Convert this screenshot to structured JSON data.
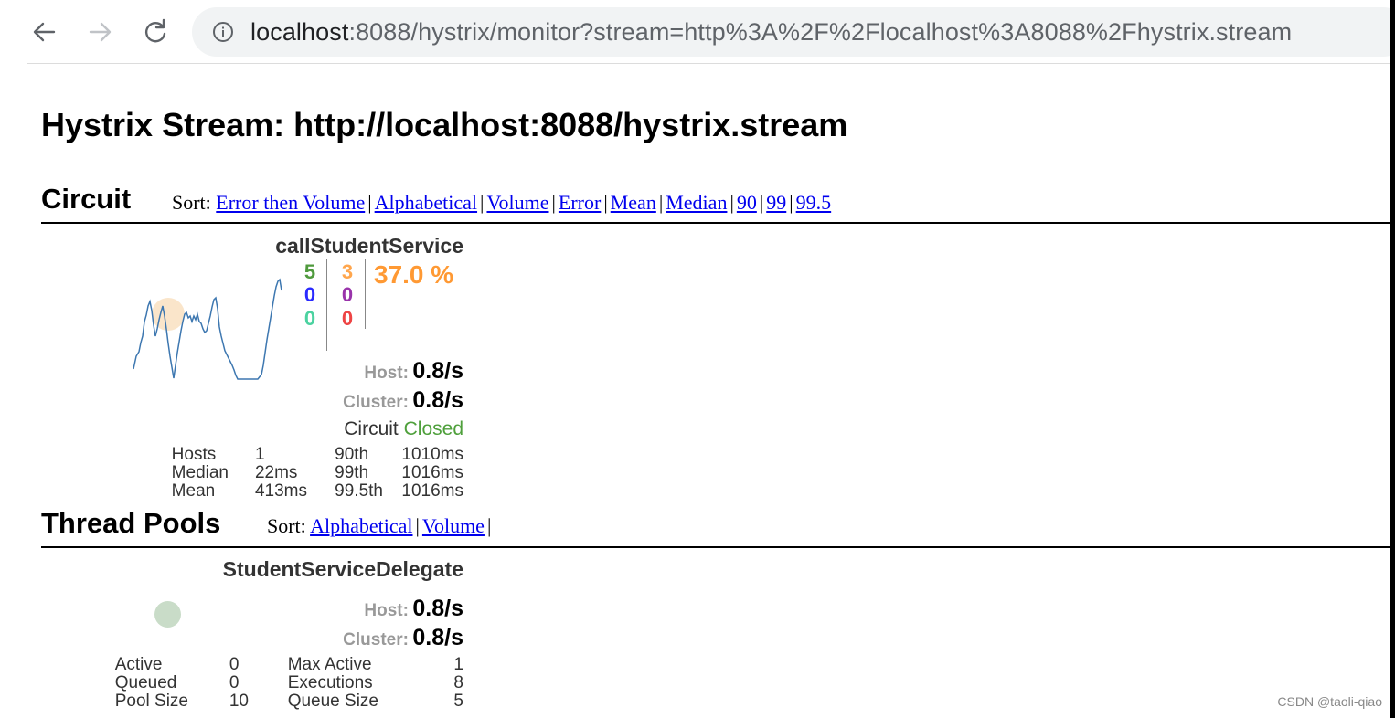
{
  "browser": {
    "back_icon": "arrow-left-icon",
    "forward_icon": "arrow-right-icon",
    "reload_icon": "reload-icon",
    "info_icon": "info-circle-icon",
    "url_host": "localhost",
    "url_rest": ":8088/hystrix/monitor?stream=http%3A%2F%2Flocalhost%3A8088%2Fhystrix.stream"
  },
  "page": {
    "title": "Hystrix Stream: http://localhost:8088/hystrix.stream"
  },
  "circuit": {
    "heading": "Circuit",
    "sort_label": "Sort:",
    "sort_options": [
      "Error then Volume",
      "Alphabetical",
      "Volume",
      "Error",
      "Mean",
      "Median",
      "90",
      "99",
      "99.5"
    ],
    "card": {
      "name": "callStudentService",
      "counts": {
        "success": "5",
        "short_circuited": "0",
        "bad_request": "0",
        "timeout": "3",
        "rejected": "0",
        "failure": "0"
      },
      "error_rate": "37.0 %",
      "host_label": "Host:",
      "host_rate": "0.8/s",
      "cluster_label": "Cluster:",
      "cluster_rate": "0.8/s",
      "circuit_label": "Circuit",
      "circuit_state": "Closed",
      "hosts_label": "Hosts",
      "hosts_value": "1",
      "median_label": "Median",
      "median_value": "22ms",
      "mean_label": "Mean",
      "mean_value": "413ms",
      "p90_label": "90th",
      "p90_value": "1010ms",
      "p99_label": "99th",
      "p99_value": "1016ms",
      "p995_label": "99.5th",
      "p995_value": "1016ms",
      "colors": {
        "success": "#4f9a3d",
        "short_circuited": "#2a2aff",
        "bad_request": "#4bd2a0",
        "timeout": "#ffa64d",
        "rejected": "#9933aa",
        "failure": "#ee4444",
        "rate": "#ff9933",
        "closed": "#4fa03c",
        "sparkline": "#3d77b0"
      }
    }
  },
  "thread_pools": {
    "heading": "Thread Pools",
    "sort_label": "Sort:",
    "sort_options": [
      "Alphabetical",
      "Volume"
    ],
    "card": {
      "name": "StudentServiceDelegate",
      "host_label": "Host:",
      "host_rate": "0.8/s",
      "cluster_label": "Cluster:",
      "cluster_rate": "0.8/s",
      "active_label": "Active",
      "active_value": "0",
      "queued_label": "Queued",
      "queued_value": "0",
      "pool_size_label": "Pool Size",
      "pool_size_value": "10",
      "max_active_label": "Max Active",
      "max_active_value": "1",
      "executions_label": "Executions",
      "executions_value": "8",
      "queue_size_label": "Queue Size",
      "queue_size_value": "5"
    }
  },
  "watermark": "CSDN @taoli-qiao"
}
